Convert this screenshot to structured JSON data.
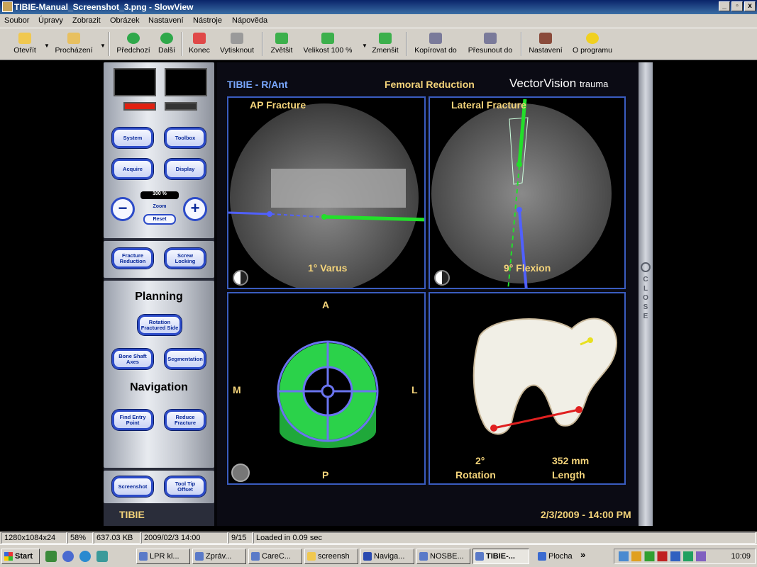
{
  "window": {
    "title": "TIBIE-Manual_Screenshot_3.png - SlowView",
    "min": "_",
    "max": "▫",
    "close": "x"
  },
  "menu": [
    "Soubor",
    "Úpravy",
    "Zobrazit",
    "Obrázek",
    "Nastavení",
    "Nástroje",
    "Nápověda"
  ],
  "toolbar": {
    "items": [
      "Otevřít",
      "Procházení",
      "Předchozí",
      "Další",
      "Konec",
      "Vytisknout",
      "Zvětšit",
      "Velikost 100 %",
      "Zmenšit",
      "Kopírovat do",
      "Přesunout do",
      "Nastavení",
      "O programu"
    ]
  },
  "app": {
    "title": "TIBIE - R/Ant",
    "mode": "Femoral Reduction",
    "brand": "VectorVision",
    "brand_sub": "trauma",
    "footer_left": "TIBIE",
    "footer_right": "2/3/2009 - 14:00 PM",
    "close_vertical": "CLOSE",
    "buttons": {
      "system": "System",
      "toolbox": "Toolbox",
      "acquire": "Acquire",
      "display": "Display",
      "zoom_pct": "100 %",
      "zoom": "Zoom",
      "reset": "Reset",
      "zoom_minus": "−",
      "zoom_plus": "+",
      "fracture_reduction": "Fracture Reduction",
      "screw_locking": "Screw Locking",
      "rotation": "Rotation Fractured Side",
      "bone_shaft": "Bone Shaft Axes",
      "segmentation": "Segmentation",
      "find_entry": "Find Entry Point",
      "reduce_fracture": "Reduce Fracture",
      "screenshot": "Screenshot",
      "tool_tip": "Tool Tip Offset"
    },
    "planning": "Planning",
    "navigation": "Navigation",
    "quads": {
      "ap_label": "AP Fracture",
      "ap_value": "1° Varus",
      "lat_label": "Lateral Fracture",
      "lat_value": "9° Flexion",
      "A": "A",
      "P": "P",
      "M": "M",
      "L": "L",
      "rotation_value": "2°",
      "rotation_label": "Rotation",
      "length_value": "352 mm",
      "length_label": "Length"
    }
  },
  "statusbar": [
    "1280x1084x24",
    "58%",
    "637.03 KB",
    "2009/02/3 14:00",
    "9/15",
    "Loaded in 0.09 sec"
  ],
  "taskbar": {
    "start": "Start",
    "tasks": [
      "LPR kl...",
      "Zpráv...",
      "CareC...",
      "screensh",
      "Naviga...",
      "NOSBE...",
      "TIBIE-...",
      "Plocha"
    ],
    "clock": "10:09"
  }
}
